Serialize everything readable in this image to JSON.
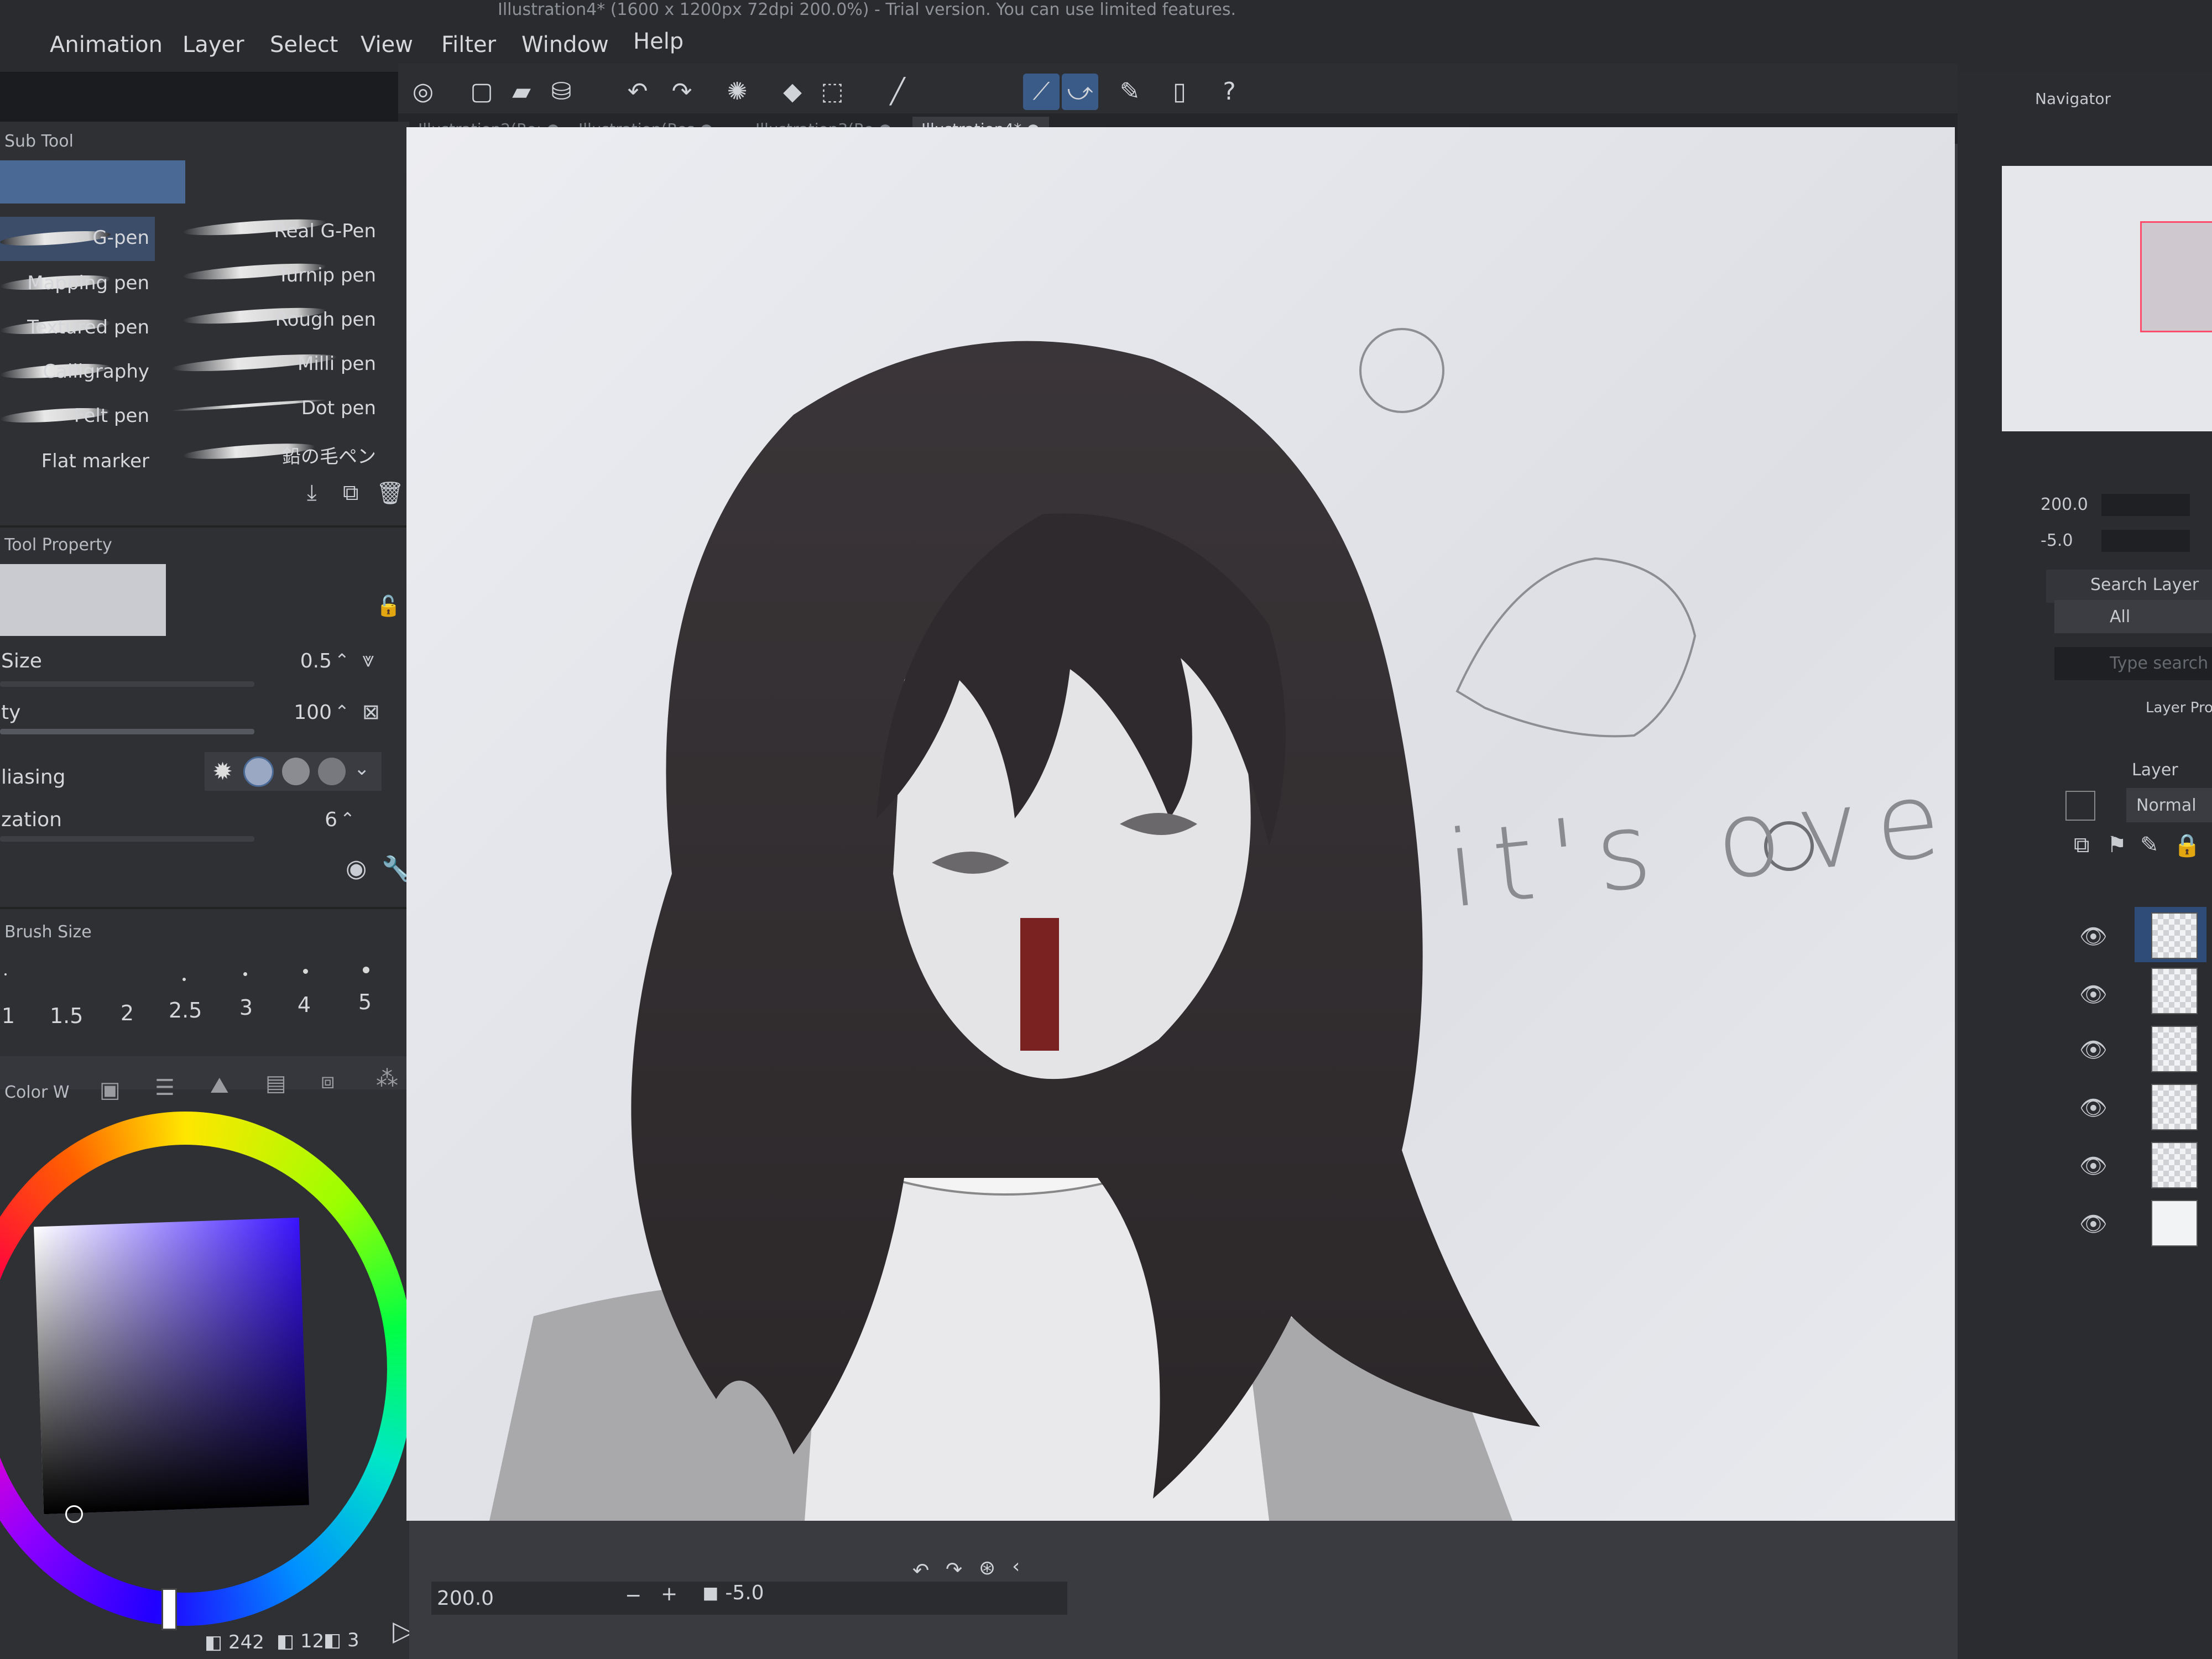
{
  "window": {
    "title": "Illustration4* (1600 x 1200px 72dpi 200.0%) - Trial version. You can use limited features."
  },
  "menu": [
    "Animation",
    "Layer",
    "Select",
    "View",
    "Filter",
    "Window",
    "Help"
  ],
  "tabs": [
    {
      "label": "Illustration2(Re:",
      "active": false
    },
    {
      "label": "Illustration(Res",
      "active": false
    },
    {
      "label": "Illustration3(Re",
      "active": false
    },
    {
      "label": "Illustration4*",
      "active": true
    }
  ],
  "subtool": {
    "title": "Sub Tool",
    "left_brushes": [
      "G-pen",
      "Mapping pen",
      "Textured pen",
      "Calligraphy",
      "Felt pen",
      "Flat marker"
    ],
    "right_brushes": [
      "Real G-Pen",
      "Turnip pen",
      "Rough pen",
      "Milli pen",
      "Dot pen",
      "鉛の毛ペン"
    ]
  },
  "toolprop": {
    "title": "Tool Property",
    "size_label": "Size",
    "size_value": "0.5",
    "opacity_label": "ty",
    "opacity_value": "100",
    "aa_label": "liasing",
    "stab_label": "zation",
    "stab_value": "6"
  },
  "brushsize": {
    "title": "Brush Size",
    "values": [
      "1",
      "1.5",
      "2",
      "2.5",
      "3",
      "4",
      "5"
    ]
  },
  "color": {
    "title": "Color W"
  },
  "statusbar": {
    "c1": "242",
    "c2": "12",
    "c3": "3"
  },
  "canvas_bottom": {
    "zoom": "200.0",
    "angle": "-5.0"
  },
  "artwork": {
    "caption": "it's over"
  },
  "navigator": {
    "title": "Navigator",
    "zoom": "200.0",
    "angle": "-5.0"
  },
  "layers": {
    "search_label": "Search Layer",
    "all_label": "All",
    "search_placeholder": "Type search",
    "layerprop_label": "Layer Pro",
    "layer_label": "Layer",
    "blend_mode": "Normal"
  },
  "colors": {
    "accent": "#3a5a88",
    "panel": "#2f3034",
    "canvas": "#e6e7eb"
  }
}
